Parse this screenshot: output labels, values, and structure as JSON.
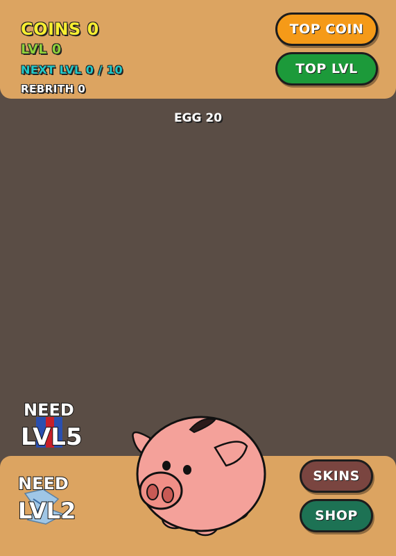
{
  "stats": {
    "coins": "COINS 0",
    "level": "LVL 0",
    "next_level": "NEXT LVL 0 / 10",
    "rebirth": "REBRITH 0"
  },
  "buttons": {
    "top_coin": "TOP COIN",
    "top_lvl": "TOP LVL",
    "skins": "SKINS",
    "shop": "SHOP"
  },
  "egg_label": "EGG 20",
  "locks": [
    {
      "line1": "NEED",
      "line2": "LVL5"
    },
    {
      "line1": "NEED",
      "line2": "LVL2"
    }
  ],
  "colors": {
    "background": "#5a4d45",
    "panel": "#dca461",
    "coins": "#f7ee31",
    "level": "#8fd13a",
    "next_level": "#22c9c9",
    "top_coin_button": "#f59a18",
    "top_lvl_button": "#1c9a3a",
    "skins_button": "#7a4540",
    "shop_button": "#1d7254",
    "pig": "#f4a19a"
  },
  "icons": {
    "main_clicker": "piggy-bank-icon"
  }
}
